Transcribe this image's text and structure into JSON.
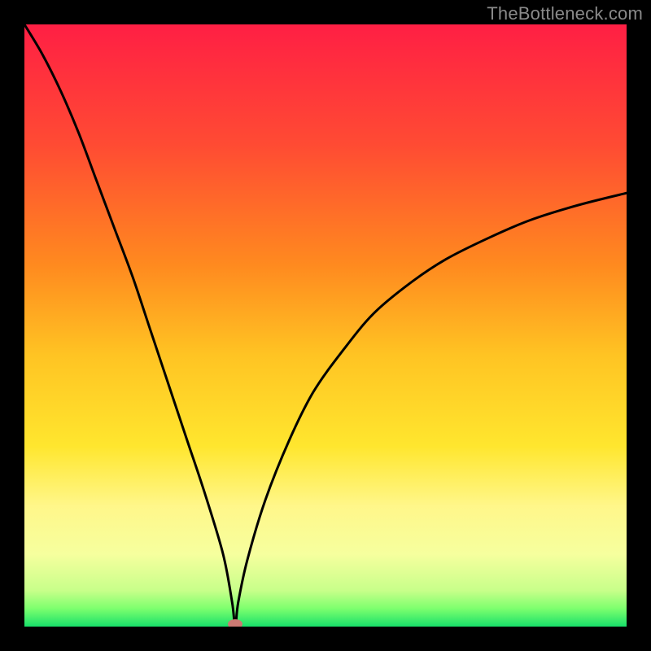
{
  "watermark": "TheBottleneck.com",
  "chart_data": {
    "type": "line",
    "title": "",
    "xlabel": "",
    "ylabel": "",
    "xlim": [
      0,
      100
    ],
    "ylim": [
      0,
      100
    ],
    "background_gradient": {
      "stops": [
        {
          "y_pct": 0,
          "color": "#ff1f44"
        },
        {
          "y_pct": 20,
          "color": "#ff4b33"
        },
        {
          "y_pct": 40,
          "color": "#ff8a1f"
        },
        {
          "y_pct": 55,
          "color": "#ffc423"
        },
        {
          "y_pct": 70,
          "color": "#ffe62e"
        },
        {
          "y_pct": 80,
          "color": "#fff78a"
        },
        {
          "y_pct": 88,
          "color": "#f6ff9e"
        },
        {
          "y_pct": 94,
          "color": "#c8ff8a"
        },
        {
          "y_pct": 97,
          "color": "#7dff6e"
        },
        {
          "y_pct": 100,
          "color": "#18e06a"
        }
      ]
    },
    "minimum_marker": {
      "x": 35,
      "y": 0,
      "color": "#cc7a73"
    },
    "curve": {
      "description": "V-shaped bottleneck curve with sharp minimum near x≈35; left branch rises steeply to top-left, right branch rises concavely to ~72% height at right edge.",
      "x": [
        0,
        3,
        6,
        9,
        12,
        15,
        18,
        21,
        24,
        27,
        30,
        33,
        34.5,
        35,
        35.5,
        37,
        40,
        44,
        48,
        53,
        58,
        64,
        70,
        77,
        84,
        92,
        100
      ],
      "y": [
        100,
        95,
        89,
        82,
        74,
        66,
        58,
        49,
        40,
        31,
        22,
        12,
        4,
        0,
        4,
        11,
        21,
        31,
        39,
        46,
        52,
        57,
        61,
        64.5,
        67.5,
        70,
        72
      ]
    }
  }
}
